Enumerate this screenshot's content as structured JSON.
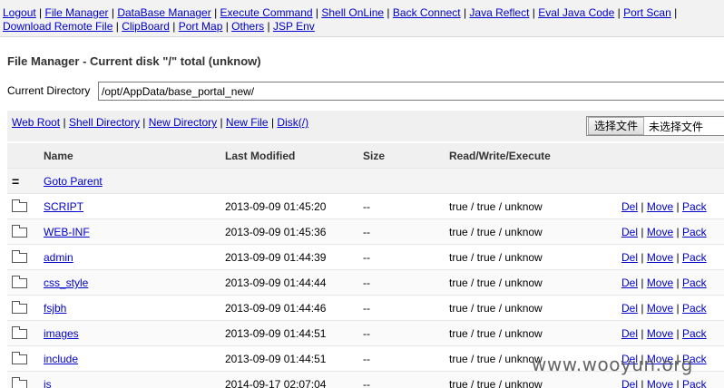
{
  "nav": {
    "items": [
      "Logout",
      "File Manager",
      "DataBase Manager",
      "Execute Command",
      "Shell OnLine",
      "Back Connect",
      "Java Reflect",
      "Eval Java Code",
      "Port Scan",
      "Download Remote File",
      "ClipBoard",
      "Port Map",
      "Others",
      "JSP Env"
    ],
    "separator": " | "
  },
  "page": {
    "title": "File Manager - Current disk \"/\" total (unknow)",
    "dir_label": "Current Directory",
    "dir_value": "/opt/AppData/base_portal_new/"
  },
  "toolbar": {
    "links": [
      "Web Root",
      "Shell Directory",
      "New Directory",
      "New File",
      "Disk(/)"
    ],
    "file_button": "选择文件",
    "file_status": "未选择文件"
  },
  "table": {
    "headers": {
      "name": "Name",
      "modified": "Last Modified",
      "size": "Size",
      "rwe": "Read/Write/Execute"
    },
    "parent": {
      "glyph": "=",
      "label": "Goto Parent"
    },
    "actions": {
      "del": "Del",
      "move": "Move",
      "pack": "Pack",
      "sep": " | "
    },
    "rows": [
      {
        "name": "SCRIPT",
        "modified": "2013-09-09 01:45:20",
        "size": "--",
        "rwe": "true / true / unknow"
      },
      {
        "name": "WEB-INF",
        "modified": "2013-09-09 01:45:36",
        "size": "--",
        "rwe": "true / true / unknow"
      },
      {
        "name": "admin",
        "modified": "2013-09-09 01:44:39",
        "size": "--",
        "rwe": "true / true / unknow"
      },
      {
        "name": "css_style",
        "modified": "2013-09-09 01:44:44",
        "size": "--",
        "rwe": "true / true / unknow"
      },
      {
        "name": "fsjbh",
        "modified": "2013-09-09 01:44:46",
        "size": "--",
        "rwe": "true / true / unknow"
      },
      {
        "name": "images",
        "modified": "2013-09-09 01:44:51",
        "size": "--",
        "rwe": "true / true / unknow"
      },
      {
        "name": "include",
        "modified": "2013-09-09 01:44:51",
        "size": "--",
        "rwe": "true / true / unknow"
      },
      {
        "name": "js",
        "modified": "2014-09-17 02:07:04",
        "size": "--",
        "rwe": "true / true / unknow"
      }
    ]
  },
  "watermark": "www.wooyun.org"
}
